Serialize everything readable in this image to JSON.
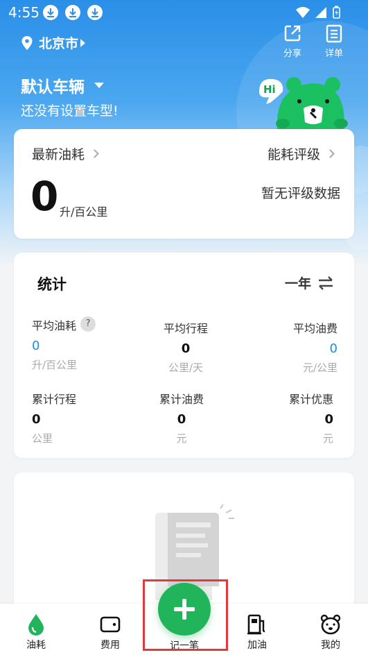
{
  "status_bar": {
    "time": "4:55"
  },
  "header": {
    "city": "北京市",
    "share_label": "分享",
    "detail_label": "详单"
  },
  "vehicle": {
    "title": "默认车辆",
    "subtitle": "还没有设置车型!"
  },
  "fuel_card": {
    "latest_label": "最新油耗",
    "rating_label": "能耗评级",
    "value": "0",
    "unit": "升/百公里",
    "no_rating_text": "暂无评级数据"
  },
  "stats": {
    "title": "统计",
    "period": "一年",
    "items": [
      {
        "label": "平均油耗",
        "value": "0",
        "unit": "升/百公里"
      },
      {
        "label": "平均行程",
        "value": "0",
        "unit": "公里/天"
      },
      {
        "label": "平均油费",
        "value": "0",
        "unit": "元/公里"
      },
      {
        "label": "累计行程",
        "value": "0",
        "unit": "公里"
      },
      {
        "label": "累计油费",
        "value": "0",
        "unit": "元"
      },
      {
        "label": "累计优惠",
        "value": "0",
        "unit": "元"
      }
    ],
    "help_mark": "?"
  },
  "bottom_nav": {
    "items": [
      {
        "label": "油耗"
      },
      {
        "label": "费用"
      },
      {
        "label": "记一笔"
      },
      {
        "label": "加油"
      },
      {
        "label": "我的"
      }
    ]
  },
  "colors": {
    "primary_blue": "#2a8fe8",
    "accent_green": "#22b45a",
    "value_blue": "#1a8ce0",
    "highlight_red": "#e23a3a"
  }
}
